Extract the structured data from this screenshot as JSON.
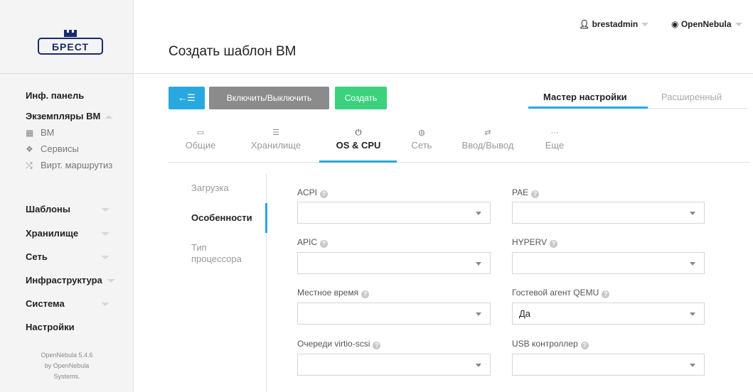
{
  "sidebar": {
    "logo_text": "БРЕСТ",
    "menu": [
      {
        "label": "Инф. панель"
      },
      {
        "label": "Экземпляры ВМ"
      },
      {
        "label": "Шаблоны"
      },
      {
        "label": "Хранилище"
      },
      {
        "label": "Сеть"
      },
      {
        "label": "Инфраструктура"
      },
      {
        "label": "Система"
      },
      {
        "label": "Настройки"
      }
    ],
    "submenu": [
      {
        "label": "ВМ",
        "icon": "grid-icon"
      },
      {
        "label": "Сервисы",
        "icon": "cubes-icon"
      },
      {
        "label": "Вирт. маршрутиз",
        "icon": "random-icon"
      }
    ],
    "footer": [
      "OpenNebula 5.4.6",
      "by OpenNebula",
      "Systems."
    ]
  },
  "header": {
    "title": "Создать шаблон ВМ",
    "user": "brestadmin",
    "zone": "OpenNebula"
  },
  "toolbar": {
    "back_icon": "←☰",
    "toggle_label": "Включить/Выключить",
    "create_label": "Создать"
  },
  "wizard": {
    "active": "Мастер настройки",
    "inactive": "Расширенный"
  },
  "sections": [
    {
      "label": "Общие",
      "icon": "laptop-icon"
    },
    {
      "label": "Хранилище",
      "icon": "storage-icon"
    },
    {
      "label": "OS & CPU",
      "icon": "power-icon"
    },
    {
      "label": "Сеть",
      "icon": "globe-icon"
    },
    {
      "label": "Ввод/Вывод",
      "icon": "exchange-icon"
    },
    {
      "label": "Еще",
      "icon": "ellipsis-icon"
    }
  ],
  "vtabs": [
    {
      "label": "Загрузка"
    },
    {
      "label": "Особенности"
    },
    {
      "label": "Тип процессора"
    }
  ],
  "fields": {
    "acpi": {
      "label": "ACPI",
      "value": ""
    },
    "pae": {
      "label": "PAE",
      "value": ""
    },
    "apic": {
      "label": "APIC",
      "value": ""
    },
    "hyperv": {
      "label": "HYPERV",
      "value": ""
    },
    "localtime": {
      "label": "Местное время",
      "value": ""
    },
    "qemu_agent": {
      "label": "Гостевой агент QEMU",
      "value": "Да"
    },
    "virtio_scsi": {
      "label": "Очереди virtio-scsi",
      "value": ""
    },
    "usb": {
      "label": "USB контроллер",
      "value": ""
    }
  },
  "colors": {
    "accent": "#29a8e0",
    "create": "#3bd17d",
    "toggle": "#8b8b8b"
  }
}
